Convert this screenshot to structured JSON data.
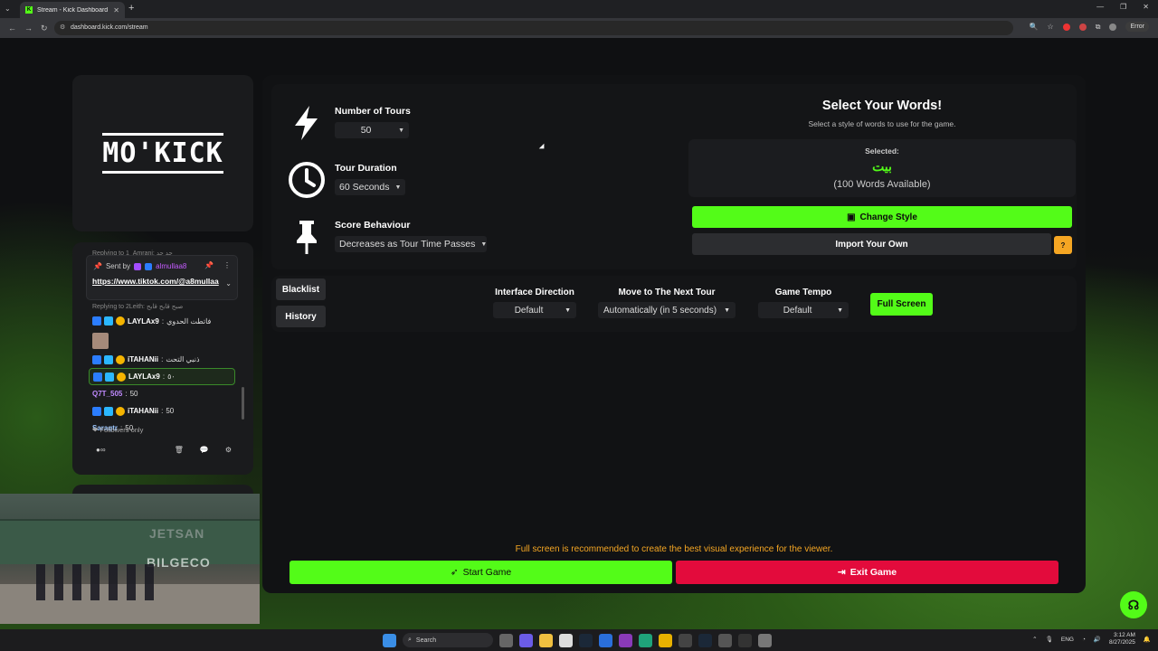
{
  "browser": {
    "tab_title": "Stream - Kick Dashboard",
    "url": "dashboard.kick.com/stream",
    "error_label": "Error"
  },
  "logo": {
    "text": "MO'KICK"
  },
  "chat": {
    "reply_hint_top": "Replying to 1_Amrani: حد حد",
    "pinned": {
      "sent_by_label": "Sent by",
      "sender": "almullaa8",
      "link": "https://www.tiktok.com/@a8mullaa"
    },
    "messages": [
      {
        "kind": "reply",
        "text": "Replying to 2Leith: صبح قابح قابح"
      },
      {
        "kind": "msg",
        "user": "LAYLAx9",
        "text": "فاتطت الحدوي",
        "style": "u1",
        "has_thumb": true
      },
      {
        "kind": "msg",
        "user": "iTAHANii",
        "text": "ذنبي التحت",
        "style": "u1"
      },
      {
        "kind": "msg",
        "user": "LAYLAx9",
        "text": "٥٠",
        "style": "u1",
        "highlight": true
      },
      {
        "kind": "msg",
        "user": "Q7T_505",
        "text": "50",
        "style": "u2"
      },
      {
        "kind": "msg",
        "user": "iTAHANii",
        "text": "50",
        "style": "u1"
      },
      {
        "kind": "msg",
        "user": "Saraqtr",
        "text": "50",
        "style": "u3"
      }
    ],
    "followers_only": "Followers only"
  },
  "webcam": {
    "text_top": "JETSAN",
    "text_bottom": "BILGECO"
  },
  "settings": {
    "tours": {
      "label": "Number of Tours",
      "value": "50"
    },
    "duration": {
      "label": "Tour Duration",
      "value": "60 Seconds"
    },
    "score": {
      "label": "Score Behaviour",
      "value": "Decreases as Tour Time Passes"
    }
  },
  "words": {
    "title": "Select Your Words!",
    "subtitle": "Select a style of words to use for the game.",
    "selected_label": "Selected:",
    "selected_value": "بيت",
    "available": "(100 Words Available)",
    "change_style": "Change Style",
    "import_own": "Import Your Own",
    "help": "?"
  },
  "options": {
    "blacklist": "Blacklist",
    "history": "History",
    "interface_direction": {
      "label": "Interface Direction",
      "value": "Default"
    },
    "next_tour": {
      "label": "Move to The Next Tour",
      "value": "Automatically (in 5 seconds)"
    },
    "tempo": {
      "label": "Game Tempo",
      "value": "Default"
    },
    "full_screen": "Full Screen"
  },
  "footer": {
    "recommend": "Full screen is recommended to create the best visual experience for the viewer.",
    "start": "Start Game",
    "exit": "Exit Game"
  },
  "taskbar": {
    "search": "Search",
    "lang": "ENG",
    "time": "3:12 AM",
    "date": "8/27/2025"
  },
  "colors": {
    "accent_green": "#53fc18",
    "exit_red": "#e30b3c",
    "warning_orange": "#f5a623"
  }
}
